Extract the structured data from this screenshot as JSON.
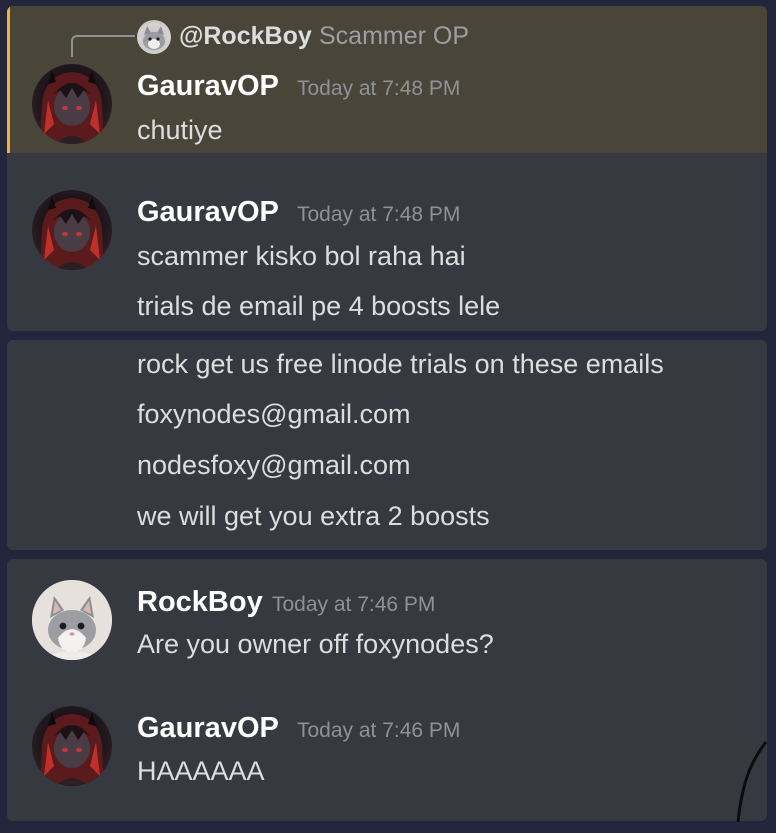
{
  "reply": {
    "username": "@RockBoy",
    "text": "Scammer OP"
  },
  "groups": [
    {
      "author": "GauravOP",
      "timestamp": "Today at 7:48 PM",
      "messages": [
        "chutiye"
      ],
      "highlighted": true
    },
    {
      "author": "GauravOP",
      "timestamp": "Today at 7:48 PM",
      "messages": [
        "scammer kisko bol raha hai",
        "trials de email pe 4 boosts lele"
      ]
    },
    {
      "messages": [
        "rock get us free linode trials on these emails",
        "foxynodes@gmail.com",
        "nodesfoxy@gmail.com",
        "we will get you extra 2 boosts"
      ]
    },
    {
      "author": "RockBoy",
      "timestamp": "Today at 7:46 PM",
      "messages": [
        "Are you owner off foxynodes?"
      ]
    },
    {
      "author": "GauravOP",
      "timestamp": "Today at 7:46 PM",
      "messages": [
        "HAAAAAA"
      ]
    }
  ],
  "colors": {
    "background": "#23253a",
    "panel": "#36393f",
    "mention_highlight": "#4a4539",
    "mention_bar": "#f0b232",
    "username": "#ffffff",
    "timestamp": "#8e9297",
    "message_text": "#dcddde"
  },
  "icons": [
    "reply-connector-icon",
    "anime-avatar",
    "cat-avatar"
  ]
}
